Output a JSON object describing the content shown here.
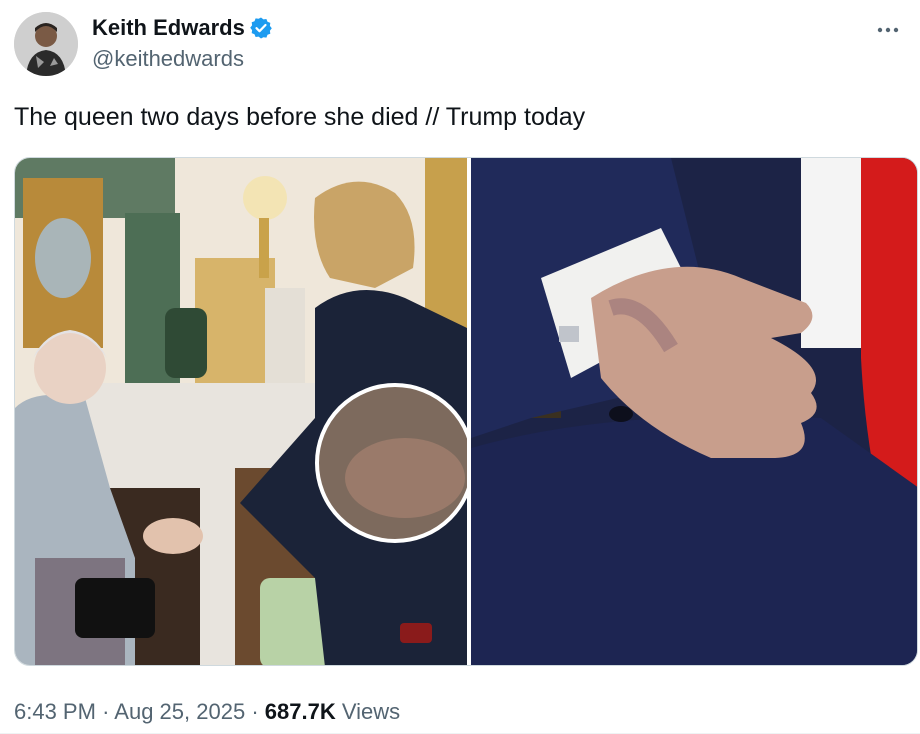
{
  "tweet": {
    "author": {
      "display_name": "Keith Edwards",
      "handle": "@keithedwards",
      "verified": true
    },
    "text": "The queen two days before she died // Trump today",
    "media": [
      {
        "icon": "photo-queen-handshake"
      },
      {
        "icon": "photo-trump-hand"
      }
    ],
    "time": "6:43 PM",
    "separator": "·",
    "date": "Aug 25, 2025",
    "views_count": "687.7K",
    "views_label": "Views"
  },
  "colors": {
    "verified": "#1d9bf0",
    "secondary_text": "#536471",
    "primary_text": "#0f1419"
  }
}
